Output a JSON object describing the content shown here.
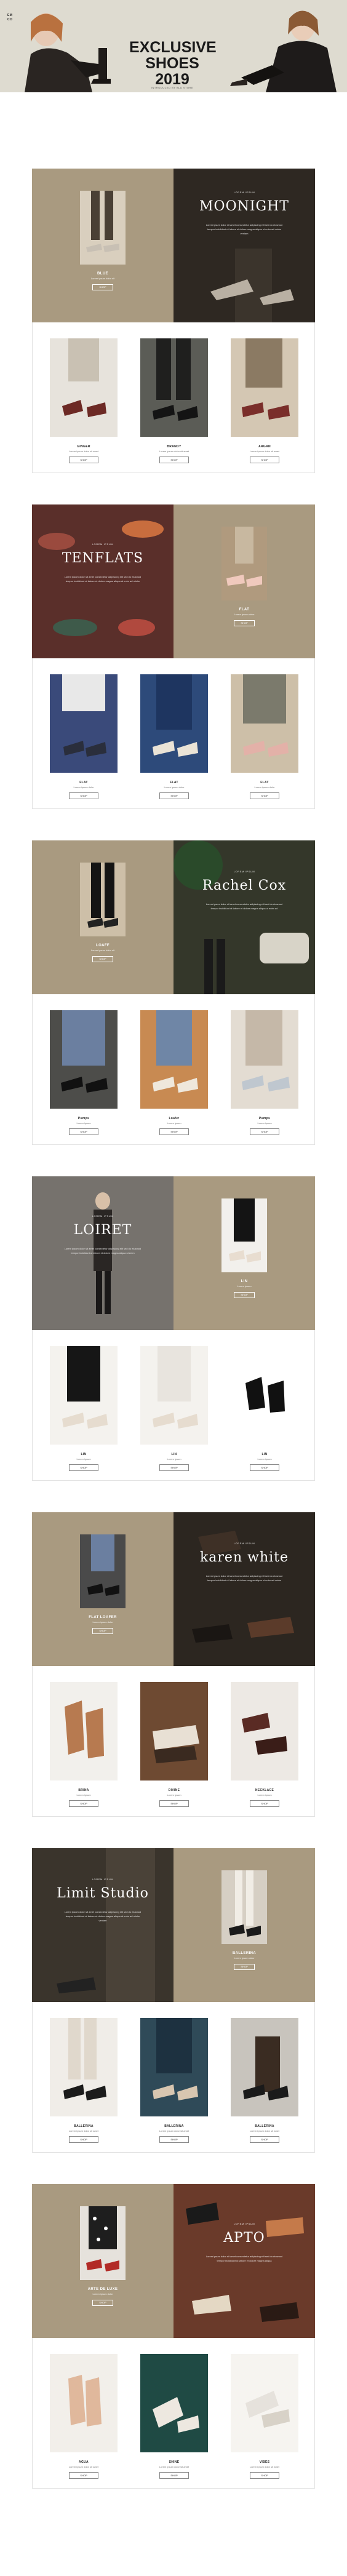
{
  "hero": {
    "brand_line1": "EMMA",
    "brand_line2": "COLLECTION",
    "year_tag": "2019",
    "title_line1": "EXCLUSIVE",
    "title_line2": "SHOES",
    "title_line3": "2019",
    "subtitle": "INTRODUCED BY BLU STORE"
  },
  "sections": [
    {
      "feature_left": {
        "type": "product",
        "name": "BLUE",
        "desc": "Lorem ipsum dolor sit",
        "shop": "SHOP"
      },
      "feature_right": {
        "type": "brand",
        "small": "LOREM IPSUM",
        "brand": "MOONIGHT",
        "para": "Lorem ipsum dolor sit amet consectetur adipiscing elit sed do eiusmod tempor incididunt ut labore et dolore magna aliqua ut enim ad minim veniam"
      },
      "cards": [
        {
          "name": "GINGER",
          "desc": "Lorem ipsum dolor sit amet",
          "shop": "SHOP"
        },
        {
          "name": "BRANDY",
          "desc": "Lorem ipsum dolor sit amet",
          "shop": "SHOP"
        },
        {
          "name": "ARGAN",
          "desc": "Lorem ipsum dolor sit amet",
          "shop": "SHOP"
        }
      ]
    },
    {
      "feature_left": {
        "type": "brand",
        "small": "LOREM IPSUM",
        "brand": "TENFLATS",
        "para": "Lorem ipsum dolor sit amet consectetur adipiscing elit sed do eiusmod tempor incididunt ut labore et dolore magna aliqua ut enim ad minim"
      },
      "feature_right": {
        "type": "product",
        "name": "FLAT",
        "desc": "Lorem ipsum dolor",
        "shop": "SHOP"
      },
      "cards": [
        {
          "name": "FLAT",
          "desc": "Lorem ipsum dolor",
          "shop": "SHOP"
        },
        {
          "name": "FLAT",
          "desc": "Lorem ipsum dolor",
          "shop": "SHOP"
        },
        {
          "name": "FLAT",
          "desc": "Lorem ipsum dolor",
          "shop": "SHOP"
        }
      ]
    },
    {
      "feature_left": {
        "type": "product",
        "name": "LOAFF",
        "desc": "Lorem ipsum dolor sit",
        "shop": "SHOP"
      },
      "feature_right": {
        "type": "brand",
        "small": "LOREM IPSUM",
        "brand": "Rachel Cox",
        "para": "Lorem ipsum dolor sit amet consectetur adipiscing elit sed do eiusmod tempor incididunt ut labore et dolore magna aliqua ut enim ad"
      },
      "cards": [
        {
          "name": "Pumps",
          "desc": "Lorem ipsum",
          "shop": "SHOP"
        },
        {
          "name": "Loafer",
          "desc": "Lorem ipsum",
          "shop": "SHOP"
        },
        {
          "name": "Pumps",
          "desc": "Lorem ipsum",
          "shop": "SHOP"
        }
      ]
    },
    {
      "feature_left": {
        "type": "brand",
        "small": "LOREM IPSUM",
        "brand": "LOIRET",
        "para": "Lorem ipsum dolor sit amet consectetur adipiscing elit sed do eiusmod tempor incididunt ut labore et dolore magna aliqua ut enim"
      },
      "feature_right": {
        "type": "product",
        "name": "LIN",
        "desc": "Lorem ipsum",
        "shop": "SHOP"
      },
      "cards": [
        {
          "name": "LIN",
          "desc": "Lorem ipsum",
          "shop": "SHOP"
        },
        {
          "name": "LIN",
          "desc": "Lorem ipsum",
          "shop": "SHOP"
        },
        {
          "name": "LIN",
          "desc": "Lorem ipsum",
          "shop": "SHOP"
        }
      ]
    },
    {
      "feature_left": {
        "type": "product",
        "name": "FLAT LOAFER",
        "desc": "Lorem ipsum dolor",
        "shop": "SHOP"
      },
      "feature_right": {
        "type": "brand",
        "small": "LOREM IPSUM",
        "brand": "karen white",
        "para": "Lorem ipsum dolor sit amet consectetur adipiscing elit sed do eiusmod tempor incididunt ut labore et dolore magna aliqua ut enim ad minim"
      },
      "cards": [
        {
          "name": "BRINA",
          "desc": "Lorem ipsum",
          "shop": "SHOP"
        },
        {
          "name": "DIVINE",
          "desc": "Lorem ipsum",
          "shop": "SHOP"
        },
        {
          "name": "NECKLACE",
          "desc": "Lorem ipsum",
          "shop": "SHOP"
        }
      ]
    },
    {
      "feature_left": {
        "type": "brand",
        "small": "LOREM IPSUM",
        "brand": "Limit Studio",
        "para": "Lorem ipsum dolor sit amet consectetur adipiscing elit sed do eiusmod tempor incididunt ut labore et dolore magna aliqua ut enim ad minim veniam"
      },
      "feature_right": {
        "type": "product",
        "name": "BALLERINA",
        "desc": "Lorem ipsum dolor",
        "shop": "SHOP"
      },
      "cards": [
        {
          "name": "BALLERINA",
          "desc": "Lorem ipsum dolor sit amet",
          "shop": "SHOP"
        },
        {
          "name": "BALLERINA",
          "desc": "Lorem ipsum dolor sit amet",
          "shop": "SHOP"
        },
        {
          "name": "BALLERINA",
          "desc": "Lorem ipsum dolor sit amet",
          "shop": "SHOP"
        }
      ]
    },
    {
      "feature_left": {
        "type": "product",
        "name": "ARTE DE LUXE",
        "desc": "Lorem ipsum dolor",
        "shop": "SHOP"
      },
      "feature_right": {
        "type": "brand",
        "small": "LOREM IPSUM",
        "brand": "APTO",
        "para": "Lorem ipsum dolor sit amet consectetur adipiscing elit sed do eiusmod tempor incididunt ut labore et dolore magna aliqua"
      },
      "cards": [
        {
          "name": "AGUA",
          "desc": "Lorem ipsum dolor sit amet",
          "shop": "SHOP"
        },
        {
          "name": "SHINE",
          "desc": "Lorem ipsum dolor sit amet",
          "shop": "SHOP"
        },
        {
          "name": "VIBES",
          "desc": "Lorem ipsum dolor sit amet",
          "shop": "SHOP"
        }
      ]
    }
  ]
}
